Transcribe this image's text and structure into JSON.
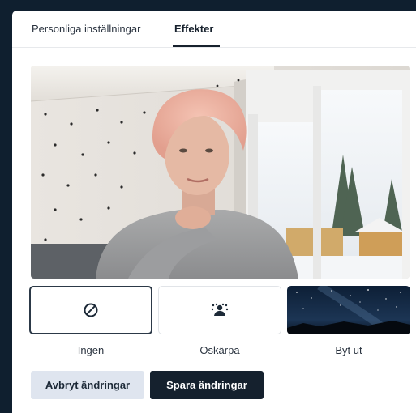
{
  "tabs": [
    {
      "label": "Personliga inställningar",
      "active": false
    },
    {
      "label": "Effekter",
      "active": true
    }
  ],
  "effects": [
    {
      "label": "Ingen",
      "icon": "none-icon",
      "selected": true
    },
    {
      "label": "Oskärpa",
      "icon": "blur-person-icon",
      "selected": false
    },
    {
      "label": "Byt ut",
      "icon": "night-sky-thumbnail",
      "selected": false
    }
  ],
  "buttons": {
    "cancel": "Avbryt ändringar",
    "save": "Spara ändringar"
  },
  "colors": {
    "page_background": "#0f1f2f",
    "primary_button": "#15212e",
    "secondary_button": "#dfe5ef",
    "selected_border": "#2c3947"
  }
}
